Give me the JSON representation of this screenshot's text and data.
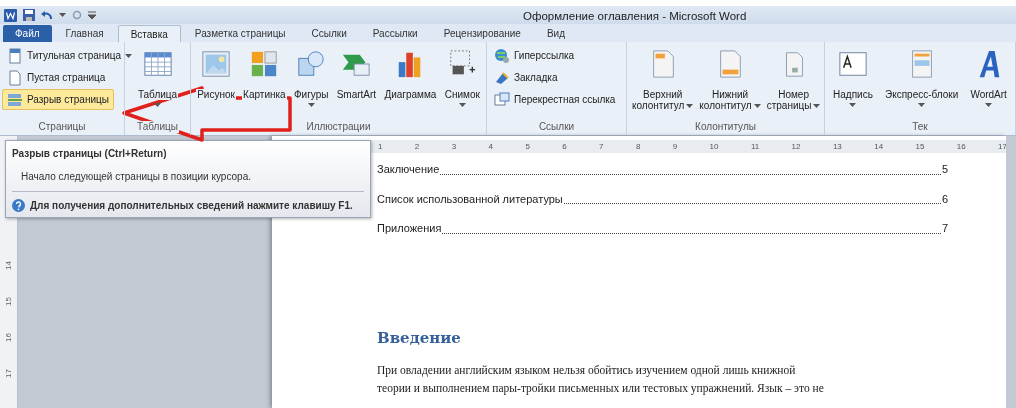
{
  "title_bar": {
    "title": "Оформление оглавления - Microsoft Word"
  },
  "tabs": [
    {
      "label": "Файл",
      "kind": "file",
      "selected": false
    },
    {
      "label": "Главная",
      "kind": "tab",
      "selected": false
    },
    {
      "label": "Вставка",
      "kind": "tab",
      "selected": true
    },
    {
      "label": "Разметка страницы",
      "kind": "tab",
      "selected": false
    },
    {
      "label": "Ссылки",
      "kind": "tab",
      "selected": false
    },
    {
      "label": "Рассылки",
      "kind": "tab",
      "selected": false
    },
    {
      "label": "Рецензирование",
      "kind": "tab",
      "selected": false
    },
    {
      "label": "Вид",
      "kind": "tab",
      "selected": false
    }
  ],
  "ribbon_groups": [
    {
      "label": "Страницы",
      "items": [
        {
          "kind": "small",
          "lines": [
            "Титульная страница"
          ],
          "dropdown": true,
          "highlighted": false
        },
        {
          "kind": "small",
          "lines": [
            "Пустая страница"
          ],
          "dropdown": false,
          "highlighted": false
        },
        {
          "kind": "small",
          "lines": [
            "Разрыв страницы"
          ],
          "dropdown": false,
          "highlighted": true
        }
      ]
    },
    {
      "label": "Таблицы",
      "items": [
        {
          "kind": "large",
          "lines": [
            "Таблица"
          ],
          "dropdown": true,
          "highlighted": false
        }
      ]
    },
    {
      "label": "Иллюстрации",
      "items": [
        {
          "kind": "large",
          "lines": [
            "Рисунок"
          ],
          "dropdown": false,
          "highlighted": false
        },
        {
          "kind": "large",
          "lines": [
            "Картинка"
          ],
          "dropdown": false,
          "highlighted": false
        },
        {
          "kind": "large",
          "lines": [
            "Фигуры"
          ],
          "dropdown": true,
          "highlighted": false
        },
        {
          "kind": "large",
          "lines": [
            "SmartArt"
          ],
          "dropdown": false,
          "highlighted": false
        },
        {
          "kind": "large",
          "lines": [
            "Диаграмма"
          ],
          "dropdown": false,
          "highlighted": false
        },
        {
          "kind": "large",
          "lines": [
            "Снимок"
          ],
          "dropdown": true,
          "highlighted": false
        }
      ]
    },
    {
      "label": "Ссылки",
      "items": [
        {
          "kind": "small",
          "lines": [
            "Гиперссылка"
          ],
          "dropdown": false,
          "highlighted": false
        },
        {
          "kind": "small",
          "lines": [
            "Закладка"
          ],
          "dropdown": false,
          "highlighted": false
        },
        {
          "kind": "small",
          "lines": [
            "Перекрестная ссылка"
          ],
          "dropdown": false,
          "highlighted": false
        }
      ]
    },
    {
      "label": "Колонтитулы",
      "items": [
        {
          "kind": "large",
          "lines": [
            "Верхний",
            "колонтитул"
          ],
          "dropdown": true,
          "highlighted": false
        },
        {
          "kind": "large",
          "lines": [
            "Нижний",
            "колонтитул"
          ],
          "dropdown": true,
          "highlighted": false
        },
        {
          "kind": "large",
          "lines": [
            "Номер",
            "страницы"
          ],
          "dropdown": true,
          "highlighted": false
        }
      ]
    },
    {
      "label": "Тек",
      "items": [
        {
          "kind": "large",
          "lines": [
            "Надпись"
          ],
          "dropdown": true,
          "highlighted": false
        },
        {
          "kind": "large",
          "lines": [
            "Экспресс-блоки"
          ],
          "dropdown": true,
          "highlighted": false
        },
        {
          "kind": "large",
          "lines": [
            "WordArt"
          ],
          "dropdown": true,
          "highlighted": false
        }
      ]
    }
  ],
  "tooltip": {
    "title": "Разрыв страницы (Ctrl+Return)",
    "description": "Начало следующей страницы в позиции курсора.",
    "help": "Для получения дополнительных сведений нажмите клавишу F1."
  },
  "ruler": {
    "numbers": [
      "1",
      "2",
      "3",
      "4",
      "5",
      "6",
      "7",
      "8",
      "9",
      "10",
      "11",
      "12",
      "13",
      "14",
      "15",
      "16",
      "17"
    ]
  },
  "vertical_ruler": {
    "numbers": [
      "14",
      "15",
      "16",
      "17"
    ]
  },
  "document": {
    "toc": [
      {
        "title": "Заключение",
        "page": "5"
      },
      {
        "title": "Список использованной литературы",
        "page": "6"
      },
      {
        "title": "Приложения",
        "page": "7"
      }
    ],
    "heading": "Введение",
    "paragraph_lines": [
      "При овладении английским языком нельзя обойтись изучением одной лишь книжной",
      "теории и выполнением пары-тройки письменных или тестовых упражнений. Язык – это не"
    ]
  }
}
